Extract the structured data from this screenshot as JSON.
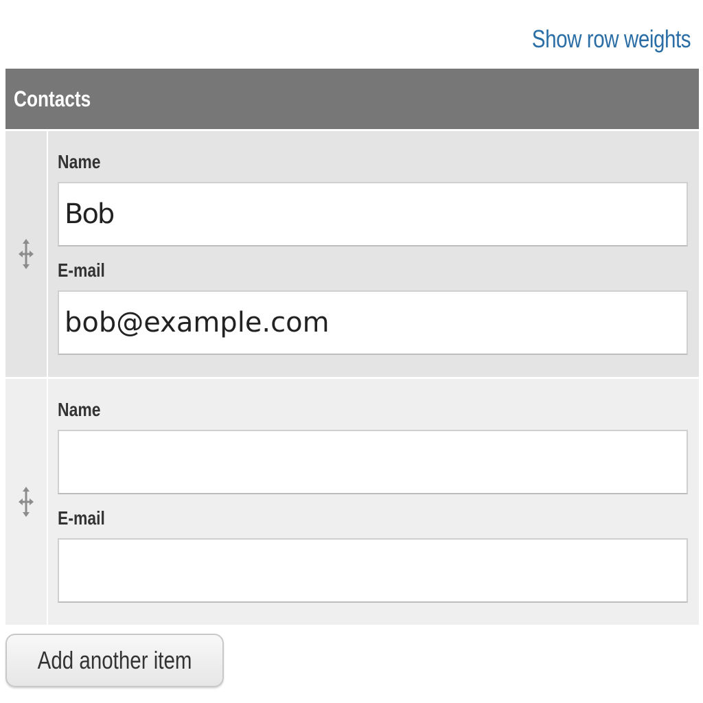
{
  "toolbar": {
    "show_row_weights_label": "Show row weights"
  },
  "table": {
    "header": "Contacts",
    "rows": [
      {
        "name_label": "Name",
        "name_value": "Bob",
        "email_label": "E-mail",
        "email_value": "bob@example.com"
      },
      {
        "name_label": "Name",
        "name_value": "",
        "email_label": "E-mail",
        "email_value": ""
      }
    ]
  },
  "actions": {
    "add_item_label": "Add another item"
  },
  "icons": {
    "drag_handle": "drag-handle-icon"
  },
  "colors": {
    "header_bg": "#777777",
    "link": "#2b6ea6",
    "row_odd": "#e4e4e4",
    "row_even": "#efefef"
  }
}
